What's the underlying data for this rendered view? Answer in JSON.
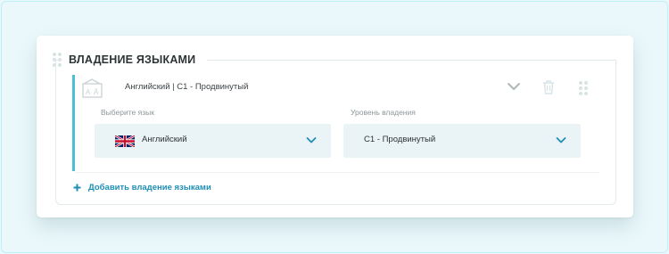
{
  "section": {
    "title": "ВЛАДЕНИЕ ЯЗЫКАМИ"
  },
  "entry": {
    "summary": "Английский | C1 - Продвинутый",
    "language_field": {
      "label": "Выберите язык",
      "value": "Английский",
      "flag": "uk-flag-icon"
    },
    "level_field": {
      "label": "Уровень владения",
      "value": "C1 - Продвинутый"
    }
  },
  "add_link": {
    "label": "Добавить владение языками"
  },
  "icons": [
    "drag-handle-icon",
    "language-icon",
    "chevron-down-icon",
    "trash-icon",
    "plus-icon"
  ],
  "colors": {
    "accent": "#4bbfd3",
    "link": "#1e8fb4",
    "field_bg": "#eaf3f5",
    "title": "#2c3436"
  }
}
